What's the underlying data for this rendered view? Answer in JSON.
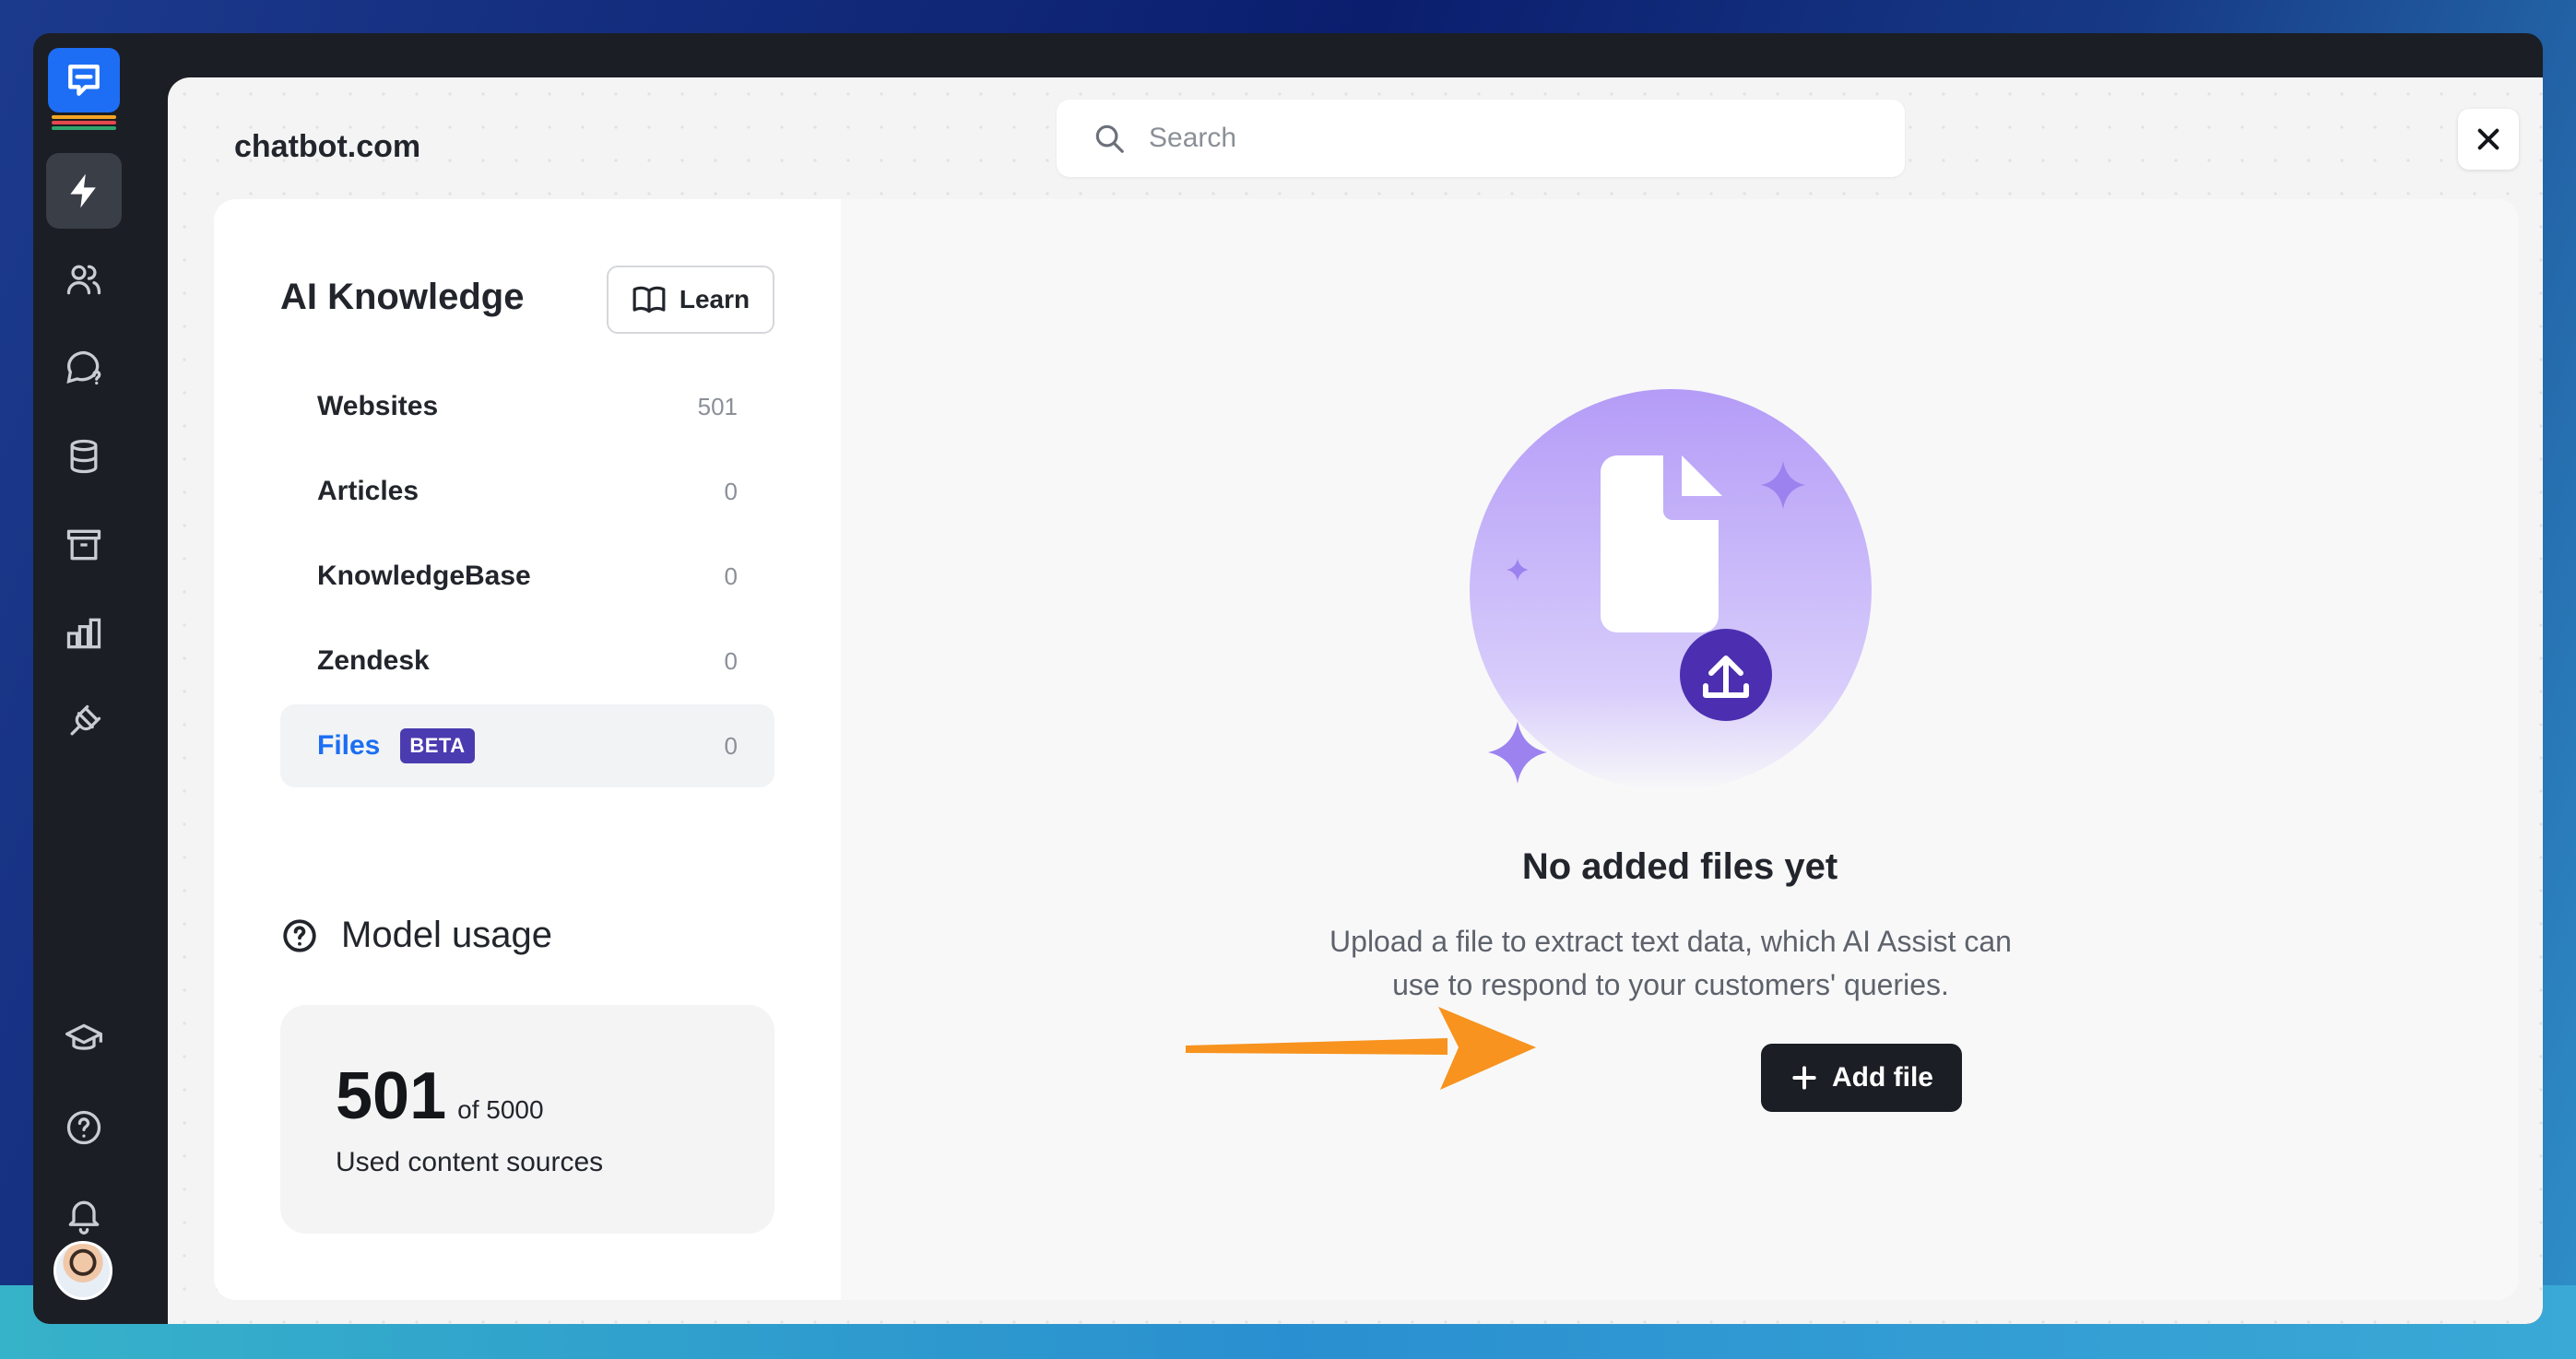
{
  "app": {
    "brand": "chatbot.com",
    "close_label": "×"
  },
  "search": {
    "placeholder": "Search"
  },
  "rail": {
    "items": [
      {
        "icon": "lightning-icon",
        "active": true
      },
      {
        "icon": "users-icon"
      },
      {
        "icon": "chat-question-icon"
      },
      {
        "icon": "database-icon"
      },
      {
        "icon": "archive-icon"
      },
      {
        "icon": "bar-chart-icon"
      },
      {
        "icon": "plug-icon"
      }
    ],
    "bottom_items": [
      {
        "icon": "graduation-cap-icon"
      },
      {
        "icon": "help-circle-icon"
      },
      {
        "icon": "bell-icon"
      }
    ],
    "accent": "#1d6ef5"
  },
  "sidebar": {
    "title": "AI Knowledge",
    "learn_label": "Learn",
    "sources": [
      {
        "label": "Websites",
        "count": "501"
      },
      {
        "label": "Articles",
        "count": "0"
      },
      {
        "label": "KnowledgeBase",
        "count": "0"
      },
      {
        "label": "Zendesk",
        "count": "0"
      },
      {
        "label": "Files",
        "count": "0",
        "badge": "BETA",
        "active": true
      }
    ],
    "usage_title": "Model usage",
    "usage_count": "501",
    "usage_of": "of 5000",
    "usage_label": "Used content sources"
  },
  "empty_state": {
    "title": "No added files yet",
    "description_line1": "Upload a file to extract text data, which AI Assist can",
    "description_line2": "use to respond to your customers' queries.",
    "add_label": "Add file",
    "illustration_icon": "file-upload-icon"
  },
  "colors": {
    "active_link": "#1b6ef3",
    "badge": "#4a3bb0",
    "primary_button": "#1b1e24",
    "arrow": "#f7931e",
    "illustration": "#b9a4f8"
  }
}
